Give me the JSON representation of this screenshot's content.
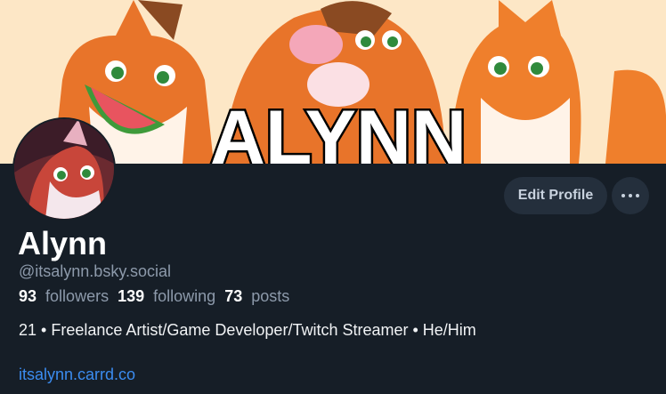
{
  "banner": {
    "text": "ALYNN"
  },
  "profile": {
    "display_name": "Alynn",
    "handle": "@itsalynn.bsky.social",
    "followers_count": "93",
    "followers_label": "followers",
    "following_count": "139",
    "following_label": "following",
    "posts_count": "73",
    "posts_label": "posts",
    "bio": "21 • Freelance Artist/Game Developer/Twitch Streamer • He/Him",
    "link": "itsalynn.carrd.co"
  },
  "actions": {
    "edit_label": "Edit Profile"
  },
  "colors": {
    "background": "#161e27",
    "button": "#242f3c",
    "link": "#3b8cf0",
    "banner_bg": "#fde7c6",
    "fox_orange": "#f28a2c"
  }
}
